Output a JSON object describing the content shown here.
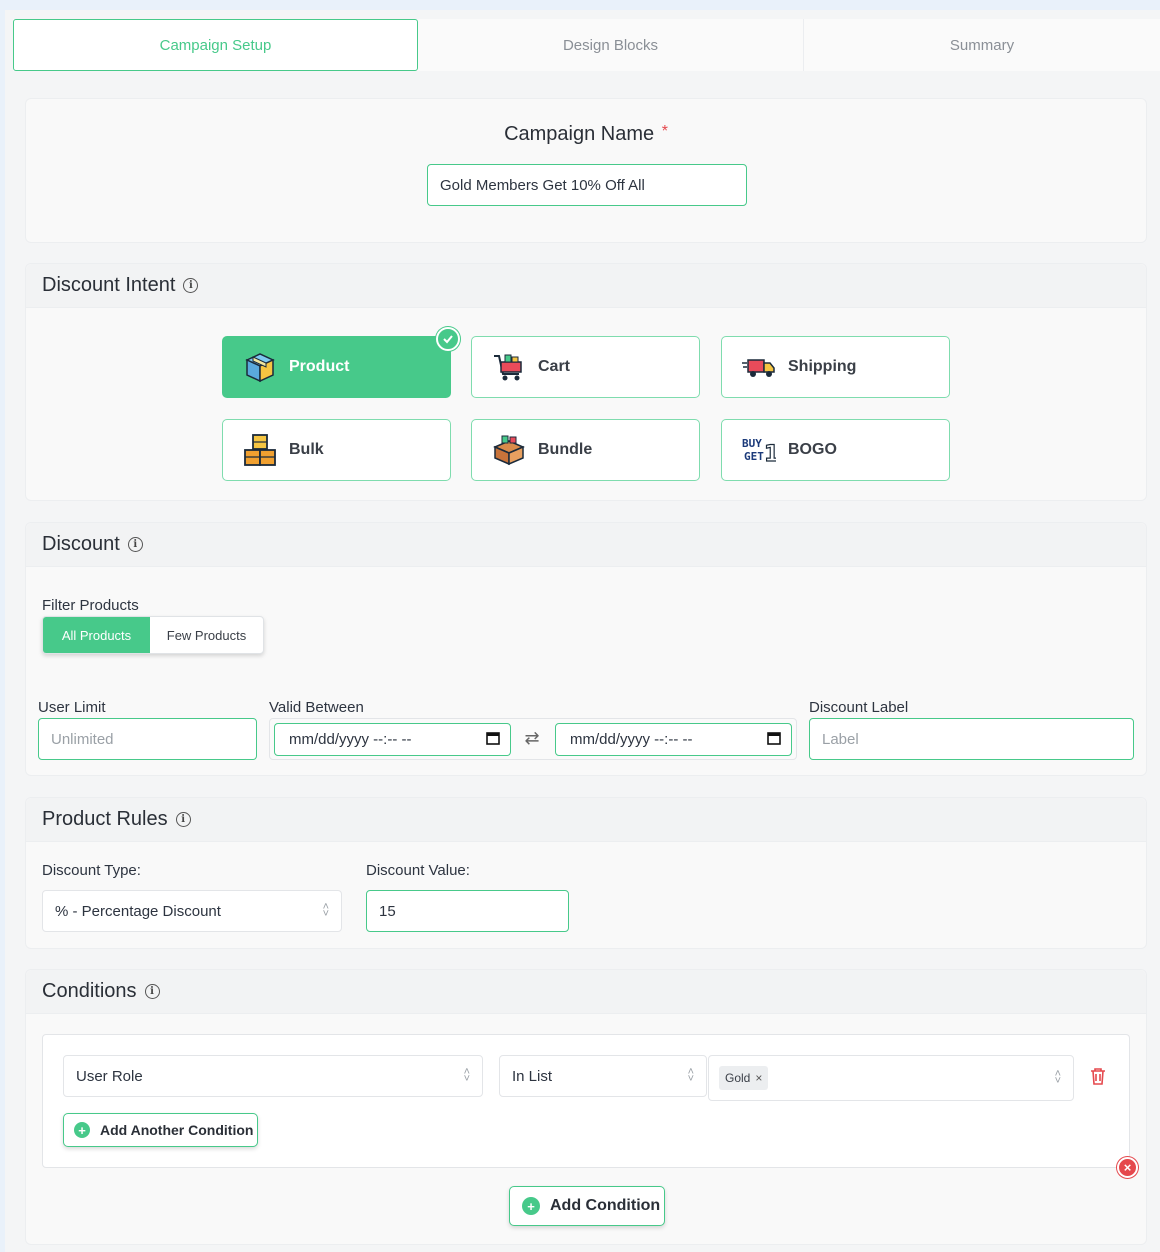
{
  "tabs": [
    "Campaign Setup",
    "Design Blocks",
    "Summary"
  ],
  "campaign": {
    "label": "Campaign Name",
    "required_mark": "*",
    "value": "Gold Members Get 10% Off All"
  },
  "discount_intent": {
    "title": "Discount Intent",
    "options": [
      {
        "label": "Product",
        "icon": "package-icon",
        "selected": true
      },
      {
        "label": "Cart",
        "icon": "shopping-cart-icon",
        "selected": false
      },
      {
        "label": "Shipping",
        "icon": "delivery-truck-icon",
        "selected": false
      },
      {
        "label": "Bulk",
        "icon": "stacked-boxes-icon",
        "selected": false
      },
      {
        "label": "Bundle",
        "icon": "bundle-box-icon",
        "selected": false
      },
      {
        "label": "BOGO",
        "icon": "buy-one-get-one-icon",
        "selected": false
      }
    ]
  },
  "discount": {
    "title": "Discount",
    "filter_label": "Filter Products",
    "filter_options": [
      "All Products",
      "Few Products"
    ],
    "filter_selected": "All Products",
    "user_limit_label": "User Limit",
    "user_limit_placeholder": "Unlimited",
    "valid_between_label": "Valid Between",
    "date_placeholder": "mm/dd/yyyy --:-- --",
    "discount_label_label": "Discount Label",
    "discount_label_placeholder": "Label"
  },
  "product_rules": {
    "title": "Product Rules",
    "type_label": "Discount Type:",
    "type_value": "% - Percentage Discount",
    "value_label": "Discount Value:",
    "value": "15"
  },
  "conditions": {
    "title": "Conditions",
    "field": "User Role",
    "operator": "In List",
    "tags": [
      "Gold"
    ],
    "add_another_label": "Add Another Condition",
    "add_label": "Add Condition"
  },
  "colors": {
    "accent": "#47c98a",
    "danger": "#e5484d"
  }
}
